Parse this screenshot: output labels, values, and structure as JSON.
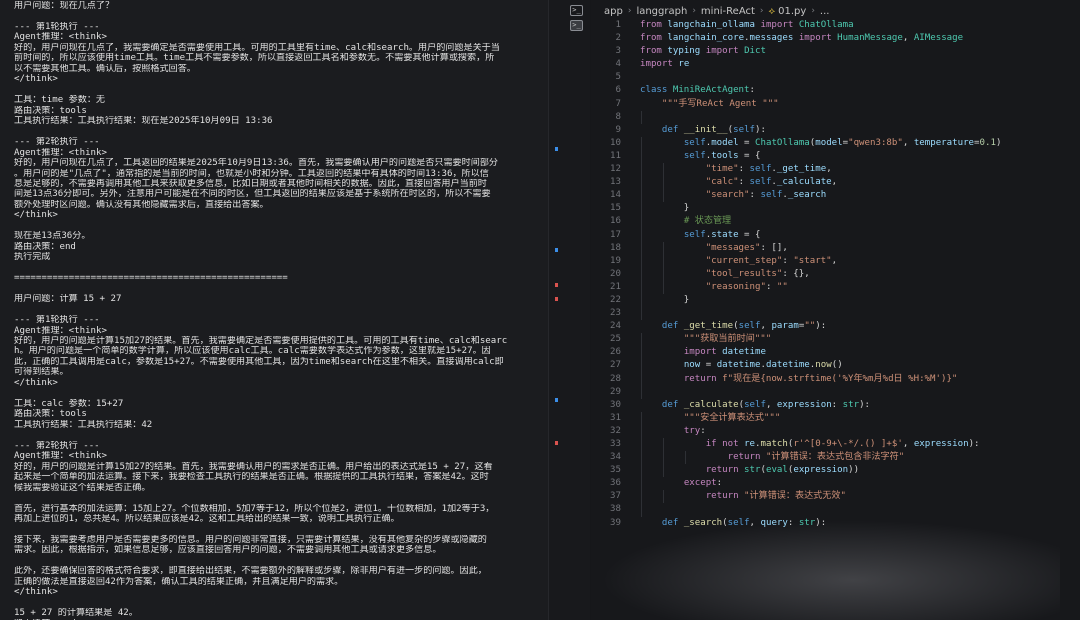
{
  "terminal": {
    "lines": [
      "用户问题：现在几点了？",
      "",
      "--- 第1轮执行 ---",
      "Agent推理：<think>",
      "好的，用户问现在几点了，我需要确定是否需要使用工具。可用的工具里有time、calc和search。用户的问题是关于当",
      "前时间的，所以应该使用time工具。time工具不需要参数，所以直接返回工具名和参数无。不需要其他计算或搜索，所",
      "以不需要其他工具。确认后，按照格式回答。",
      "</think>",
      "",
      "工具：time 参数：无",
      "路由决策：tools",
      "工具执行结果：工具执行结果：现在是2025年10月09日 13:36",
      "",
      "--- 第2轮执行 ---",
      "Agent推理：<think>",
      "好的，用户问现在几点了，工具返回的结果是2025年10月9日13:36。首先，我需要确认用户的问题是否只需要时间部分",
      "。用户问的是\"几点了\"，通常指的是当前的时间，也就是小时和分钟。工具返回的结果中有具体的时间13:36，所以信",
      "息是足够的，不需要再调用其他工具来获取更多信息，比如日期或者其他时间相关的数据。因此，直接回答用户当前时",
      "间是13点36分即可。另外，注意用户可能是在不同的时区，但工具返回的结果应该是基于系统所在时区的，所以不需要",
      "额外处理时区问题。确认没有其他隐藏需求后，直接给出答案。",
      "</think>",
      "",
      "现在是13点36分。",
      "路由决策：end",
      "执行完成",
      "",
      "==================================================",
      "",
      "用户问题：计算 15 + 27",
      "",
      "--- 第1轮执行 ---",
      "Agent推理：<think>",
      "好的，用户的问题是计算15加27的结果。首先，我需要确定是否需要使用提供的工具。可用的工具有time、calc和searc",
      "h。用户的问题是一个简单的数学计算，所以应该使用calc工具。calc需要数学表达式作为参数，这里就是15+27。因",
      "此，正确的工具调用是calc，参数是15+27。不需要使用其他工具，因为time和search在这里不相关。直接调用calc即",
      "可得到结果。",
      "</think>",
      "",
      "工具：calc 参数：15+27",
      "路由决策：tools",
      "工具执行结果：工具执行结果：42",
      "",
      "--- 第2轮执行 ---",
      "Agent推理：<think>",
      "好的，用户的问题是计算15加27的结果。首先，我需要确认用户的需求是否正确。用户给出的表达式是15 + 27，这看",
      "起来是一个简单的加法运算。接下来，我要检查工具执行的结果是否正确。根据提供的工具执行结果，答案是42。这时",
      "候我需要验证这个结果是否正确。",
      "",
      "首先，进行基本的加法运算：15加上27。个位数相加，5加7等于12，所以个位是2，进位1。十位数相加，1加2等于3，",
      "再加上进位的1，总共是4。所以结果应该是42。这和工具给出的结果一致，说明工具执行正确。",
      "",
      "接下来，我需要考虑用户是否需要更多的信息。用户的问题非常直接，只需要计算结果，没有其他复杂的步骤或隐藏的",
      "需求。因此，根据指示，如果信息足够，应该直接回答用户的问题，不需要调用其他工具或请求更多信息。",
      "",
      "此外，还要确保回答的格式符合要求，即直接给出结果，不需要额外的解释或步骤，除非用户有进一步的问题。因此，",
      "正确的做法是直接返回42作为答案，确认工具的结果正确，并且满足用户的需求。",
      "</think>",
      "",
      "15 + 27 的计算结果是 42。",
      "路由决策：end"
    ]
  },
  "icons": {
    "terminal_icon": "terminal-icon",
    "python_file_icon": "python-file-icon"
  },
  "editor": {
    "breadcrumb": [
      "app",
      "langgraph",
      "mini-ReAct",
      "01.py",
      "..."
    ],
    "line_numbers": [
      "1",
      "2",
      "3",
      "4",
      "5",
      "6",
      "7",
      "8",
      "9",
      "10",
      "11",
      "12",
      "13",
      "14",
      "15",
      "16",
      "17",
      "18",
      "19",
      "20",
      "21",
      "22",
      "23",
      "24",
      "25",
      "26",
      "27",
      "28",
      "29",
      "30",
      "31",
      "32",
      "33",
      "34",
      "35",
      "36",
      "37",
      "38",
      "39"
    ],
    "code_lines": [
      "from langchain_ollama import ChatOllama",
      "from langchain_core.messages import HumanMessage, AIMessage",
      "from typing import Dict",
      "import re",
      "",
      "class MiniReActAgent:",
      "    \"\"\"手写ReAct Agent \"\"\"",
      "",
      "    def __init__(self):",
      "        self.model = ChatOllama(model=\"qwen3:8b\", temperature=0.1)",
      "        self.tools = {",
      "            \"time\": self._get_time,",
      "            \"calc\": self._calculate,",
      "            \"search\": self._search",
      "        }",
      "        # 状态管理",
      "        self.state = {",
      "            \"messages\": [],",
      "            \"current_step\": \"start\",",
      "            \"tool_results\": {},",
      "            \"reasoning\": \"\"",
      "        }",
      "",
      "    def _get_time(self, param=\"\"):",
      "        \"\"\"获取当前时间\"\"\"",
      "        import datetime",
      "        now = datetime.datetime.now()",
      "        return f\"现在是{now.strftime('%Y年%m月%d日 %H:%M')}\"",
      "",
      "    def _calculate(self, expression: str):",
      "        \"\"\"安全计算表达式\"\"\"",
      "        try:",
      "            if not re.match(r'^[0-9+\\-*/.() ]+$', expression):",
      "                return \"计算错误：表达式包含非法字符\"",
      "            return str(eval(expression))",
      "        except:",
      "            return \"计算错误：表达式无效\"",
      "",
      "    def _search(self, query: str):"
    ]
  },
  "colors": {
    "terminal_bg": "#1b1c1f",
    "editor_bg": "#17181b",
    "keyword": "#c586c0",
    "def_keyword": "#569cd6",
    "function": "#dcdcaa",
    "class_name": "#4ec9b0",
    "string": "#ce9178",
    "number": "#b5cea8",
    "variable": "#9cdcfe",
    "comment": "#6a9955",
    "gutter_marker_blue": "#3b8ee8",
    "gutter_marker_red": "#d9534f"
  }
}
